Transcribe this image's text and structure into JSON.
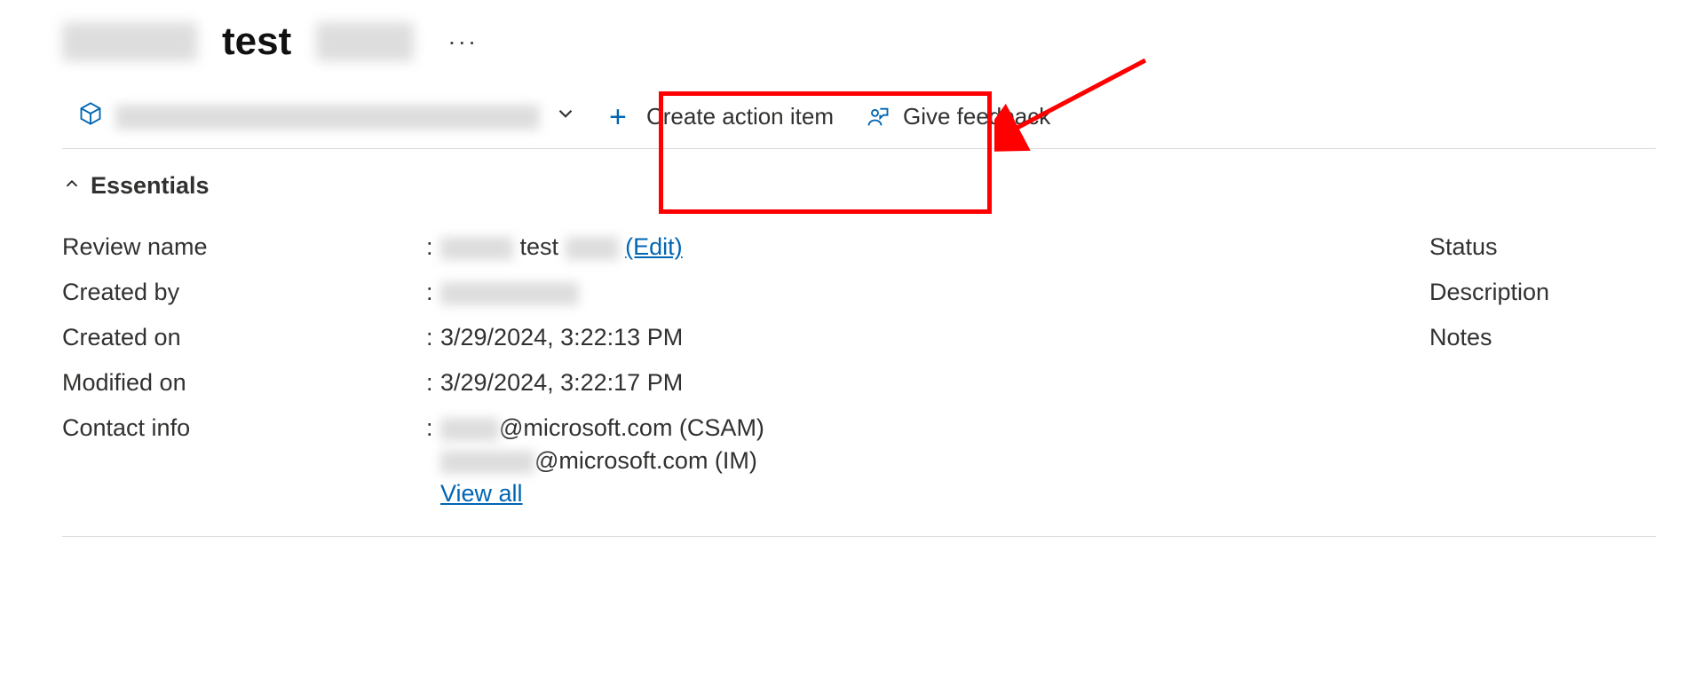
{
  "header": {
    "title_middle": "test",
    "more_label": "···"
  },
  "toolbar": {
    "create_action_item_label": "Create action item",
    "give_feedback_label": "Give feedback"
  },
  "essentials": {
    "section_title": "Essentials",
    "left": {
      "review_name": {
        "label": "Review name",
        "visible_text": "test",
        "edit_label": "(Edit)"
      },
      "created_by": {
        "label": "Created by"
      },
      "created_on": {
        "label": "Created on",
        "value": "3/29/2024, 3:22:13 PM"
      },
      "modified_on": {
        "label": "Modified on",
        "value": "3/29/2024, 3:22:17 PM"
      },
      "contact_info": {
        "label": "Contact info",
        "line1_suffix": "@microsoft.com (CSAM)",
        "line2_suffix": "@microsoft.com (IM)",
        "view_all_label": "View all"
      }
    },
    "right": {
      "status_label": "Status",
      "description_label": "Description",
      "notes_label": "Notes"
    }
  },
  "annotation": {
    "highlight_target": "create-action-item-button"
  }
}
